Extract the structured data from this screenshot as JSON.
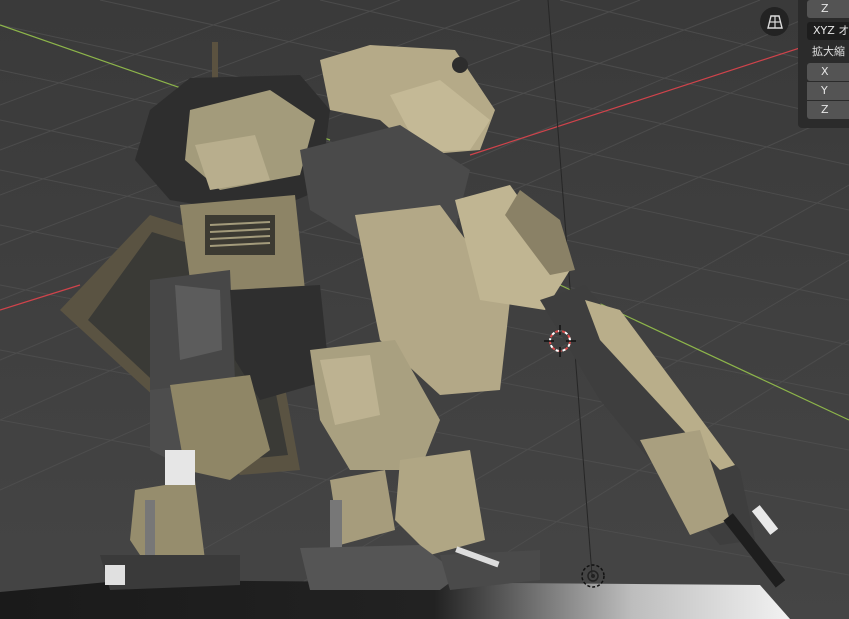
{
  "scene": {
    "background_color": "#3d3d3d",
    "floor_color": "#1a1a1a",
    "robot_primary_color": "#b3a887",
    "robot_secondary_color": "#4a4a4a",
    "x_axis_color": "#d0434b",
    "y_axis_color": "#8db54a"
  },
  "side_panel": {
    "z_top": "Z",
    "mode_label": "XYZ オ",
    "scale_label": "拡大縮",
    "scale_x": "X",
    "scale_y": "Y",
    "scale_z": "Z"
  },
  "icons": {
    "grid_toggle": "grid-perspective-icon",
    "origin": "origin-marker-icon",
    "cursor": "3d-cursor-icon"
  }
}
